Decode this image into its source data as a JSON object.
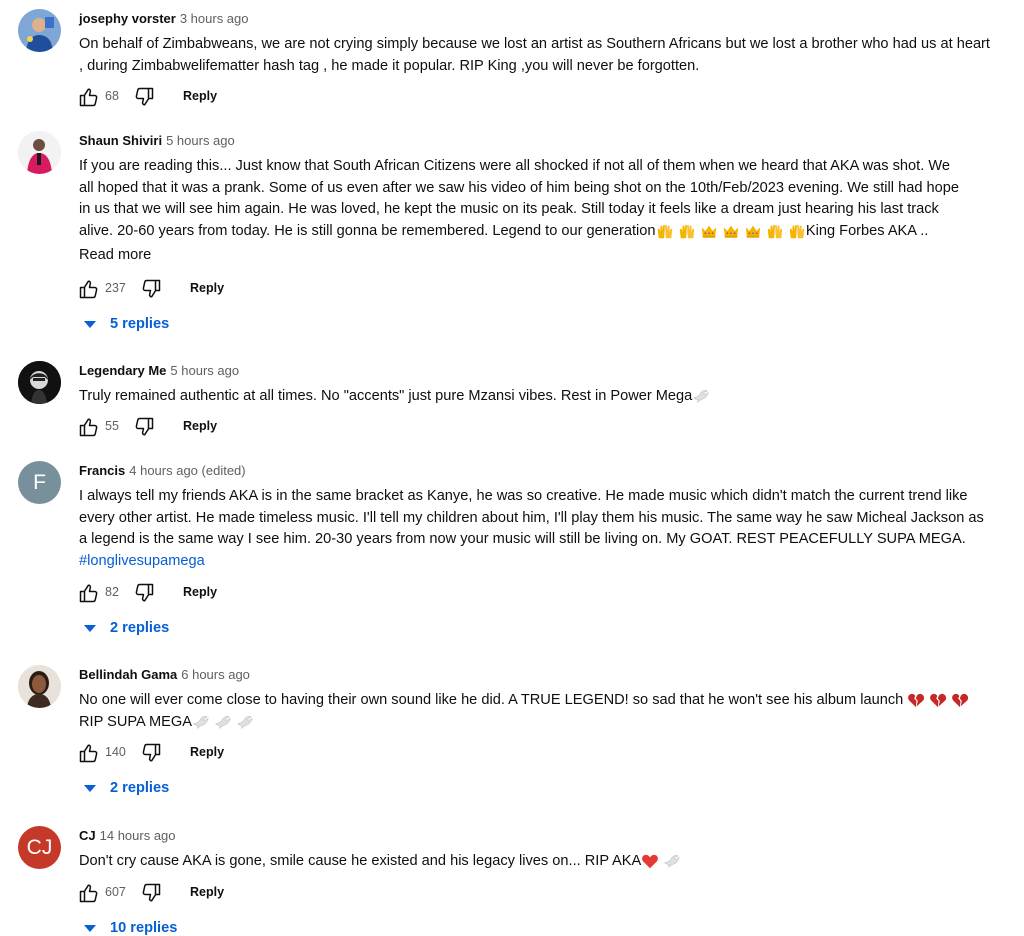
{
  "comments": [
    {
      "author": "josephy vorster",
      "time": "3 hours ago",
      "text": "On behalf of Zimbabweans, we are not crying simply because we lost an artist as Southern Africans but we lost a brother who had us at heart , during Zimbabwelifematter hash tag , he made it popular. RIP King ,you will never be forgotten.",
      "likes": "68",
      "reply_label": "Reply",
      "avatar_icon": "photo-avatar-icon"
    },
    {
      "author": "Shaun Shiviri",
      "time": "5 hours ago",
      "text_lines": [
        "If you are reading this... Just know that South African Citizens were all shocked if not all of them when we heard that AKA was shot. We",
        "all hoped that it was a prank. Some of us even after we saw his video of him being shot on the 10th/Feb/2023 evening. We still had hope",
        "in us that we will see him again. He was loved,  he kept the music on its peak. Still today it feels like a dream just hearing his last track",
        "alive. 20-60 years from today. He is still gonna be remembered. Legend to our generation"
      ],
      "text_end": "King Forbes AKA ..",
      "emoji_sequence": [
        "raising-hands-icon",
        "raising-hands-icon",
        "crown-icon",
        "crown-icon",
        "crown-icon",
        "raising-hands-icon",
        "raising-hands-icon"
      ],
      "read_more": "Read more",
      "likes": "237",
      "reply_label": "Reply",
      "replies": "5 replies",
      "avatar_icon": "photo-avatar-icon"
    },
    {
      "author": "Legendary Me",
      "time": "5 hours ago",
      "text": "Truly remained authentic at all times. No \"accents\" just pure Mzansi vibes. Rest in Power Mega",
      "emoji_sequence": [
        "dove-icon"
      ],
      "likes": "55",
      "reply_label": "Reply",
      "avatar_icon": "photo-avatar-icon"
    },
    {
      "author": "Francis",
      "time": "4 hours ago (edited)",
      "text": "I always tell my friends AKA is in the same bracket as Kanye, he was so creative. He made music which didn't match the current trend like every other artist. He made timeless music. I'll tell my children about him, I'll play them his music. The same way he saw Micheal Jackson as a legend is the same way I see him. 20-30 years from now your music will still be living on. My GOAT. REST PEACEFULLY SUPA MEGA. ",
      "hashtag": "#longlivesupamega",
      "likes": "82",
      "reply_label": "Reply",
      "replies": "2 replies",
      "avatar_letter": "F",
      "avatar_color": "#78909c"
    },
    {
      "author": "Bellindah Gama",
      "time": "6 hours ago",
      "text_line1": "No one will ever come close to having their own sound like he did. A TRUE LEGEND! so sad that he won't see his album launch ",
      "text_line2": "RIP SUPA MEGA",
      "emoji_sequence_1": [
        "broken-heart-icon",
        "broken-heart-icon",
        "broken-heart-icon"
      ],
      "emoji_sequence_2": [
        "dove-icon",
        "dove-icon",
        "dove-icon"
      ],
      "likes": "140",
      "reply_label": "Reply",
      "replies": "2 replies",
      "avatar_icon": "photo-avatar-icon"
    },
    {
      "author": "CJ",
      "time": "14 hours ago",
      "text": "Don't cry cause AKA is gone, smile cause he existed and his legacy lives on... RIP AKA",
      "emoji_sequence": [
        "red-heart-icon",
        "dove-icon"
      ],
      "likes": "607",
      "reply_label": "Reply",
      "replies": "10 replies",
      "avatar_letter": "CJ",
      "avatar_color": "#c53929"
    }
  ]
}
